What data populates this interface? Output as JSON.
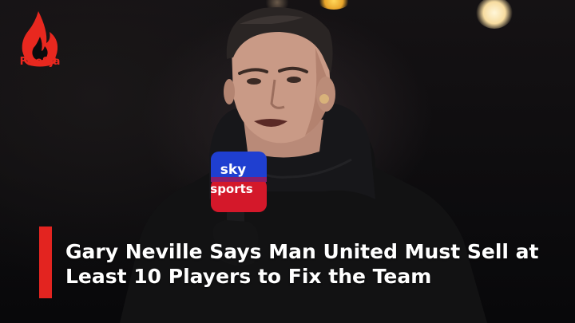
{
  "brand": {
    "logo_text": "Fire9ja"
  },
  "mic": {
    "line1": "sky",
    "line2": "sports"
  },
  "headline": {
    "line1": "Gary Neville Says Man United Must Sell at",
    "line2": "Least 10 Players to Fix the Team"
  },
  "colors": {
    "accent": "#e32420",
    "text": "#ffffff",
    "mic_blue": "#1f3fd0",
    "mic_red": "#d4182a"
  }
}
